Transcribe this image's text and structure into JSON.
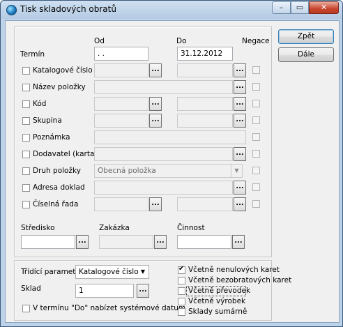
{
  "window": {
    "title": "Tisk skladových obratů",
    "min_label": "–",
    "max_label": "▭",
    "close_label": "✕"
  },
  "buttons": {
    "ok_label": "Zpět",
    "next_label": "Dále"
  },
  "headers": {
    "od": "Od",
    "do": "Do",
    "negace": "Negace"
  },
  "termin": {
    "label": "Termín",
    "od_value": " .  .",
    "do_value": "31.12.2012"
  },
  "rows": [
    {
      "label": "Katalogové číslo",
      "has_od_btn": true,
      "has_do": true
    },
    {
      "label": "Název položky"
    },
    {
      "label": "Kód"
    },
    {
      "label": "Skupina"
    },
    {
      "label": "Poznámka"
    },
    {
      "label": "Dodavatel (karta)"
    },
    {
      "label": "Druh položky",
      "value": "Obecná položka"
    },
    {
      "label": "Adresa doklad"
    },
    {
      "label": "Číselná řada"
    }
  ],
  "ellipsis": "...",
  "lower": {
    "stredisko": "Středisko",
    "zakazka": "Zakázka",
    "cinnost": "Činnost"
  },
  "options": {
    "tridici_label": "Třídící parametr",
    "tridici_value": "Katalogové číslo",
    "sklad_label": "Sklad",
    "sklad_value": "1",
    "system_date_label": "V termínu \"Do\" nabízet systémové datum"
  },
  "checks": [
    {
      "label": "Včetně nenulových karet",
      "checked": true
    },
    {
      "label": "Včetně bezobratových karet",
      "checked": false
    },
    {
      "label": "Včetně převodek",
      "checked": false
    },
    {
      "label": "Včetně výrobek",
      "checked": false
    },
    {
      "label": "Sklady sumárně",
      "checked": false
    }
  ]
}
